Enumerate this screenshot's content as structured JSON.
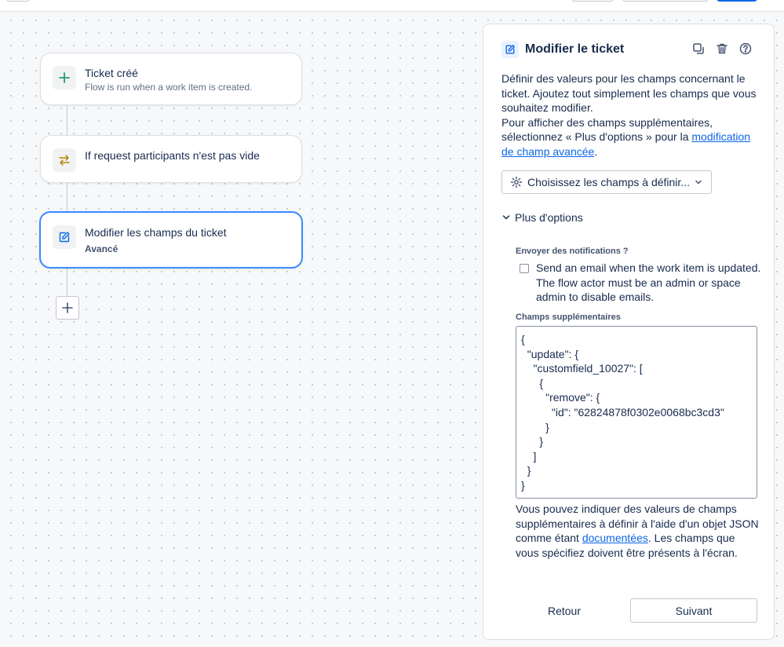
{
  "flow": {
    "nodes": [
      {
        "title": "Ticket créé",
        "subtitle": "Flow is run when a work item is created.",
        "icon": "plus-icon"
      },
      {
        "title": "If request participants n'est pas vide",
        "subtitle": "",
        "icon": "swap-arrows-icon"
      },
      {
        "title": "Modifier les champs du ticket",
        "subtitle": "Avancé",
        "icon": "edit-icon",
        "selected": true
      }
    ],
    "add_icon": "plus-icon"
  },
  "panel": {
    "title": "Modifier le ticket",
    "actions": [
      "duplicate-icon",
      "trash-icon",
      "help-icon"
    ],
    "description": {
      "line1": "Définir des valeurs pour les champs concernant le ticket. Ajoutez tout simplement les champs que vous souhaitez modifier.",
      "line2_pre": "Pour afficher des champs supplémentaires, sélectionnez « Plus d'options » pour la ",
      "line2_link": "modification de champ avancée",
      "line2_post": "."
    },
    "field_select": {
      "label": "Choisissez les champs à définir..."
    },
    "more_options": {
      "label": "Plus d'options"
    },
    "notifications": {
      "label": "Envoyer des notifications ?",
      "checkbox_text": "Send an email when the work item is updated. The flow actor must be an admin or space admin to disable emails.",
      "checked": false
    },
    "additional_fields": {
      "label": "Champs supplémentaires",
      "value": "{\n  \"update\": {\n    \"customfield_10027\": [\n      {\n        \"remove\": {\n          \"id\": \"62824878f0302e0068bc3cd3\"\n        }\n      }\n    ]\n  }\n}",
      "help_pre": "Vous pouvez indiquer des valeurs de champs supplémentaires à définir à l'aide d'un objet JSON comme étant ",
      "help_link": "documentées",
      "help_post": ". Les champs que vous spécifiez doivent être présents à l'écran."
    },
    "footer": {
      "back_label": "Retour",
      "next_label": "Suivant"
    }
  },
  "colors": {
    "accent": "#0c66e4",
    "selected_border": "#388bff",
    "success": "#22a06b",
    "warning": "#b38600"
  }
}
